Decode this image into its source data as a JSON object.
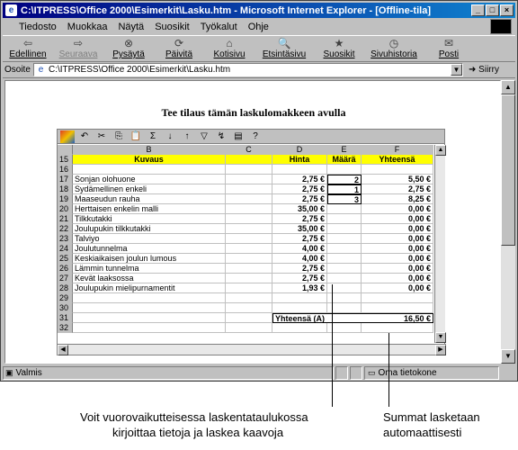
{
  "window": {
    "title": "C:\\ITPRESS\\Office 2000\\Esimerkit\\Lasku.htm - Microsoft Internet Explorer - [Offline-tila]",
    "buttons": [
      "_",
      "□",
      "×"
    ]
  },
  "menu": [
    "Tiedosto",
    "Muokkaa",
    "Näytä",
    "Suosikit",
    "Työkalut",
    "Ohje"
  ],
  "toolbar": [
    {
      "label": "Edellinen",
      "icon": "back-arrow-icon",
      "glyph": "⇦",
      "disabled": false
    },
    {
      "label": "Seuraava",
      "icon": "forward-arrow-icon",
      "glyph": "⇨",
      "disabled": true
    },
    {
      "label": "Pysäytä",
      "icon": "stop-icon",
      "glyph": "⊗",
      "disabled": false
    },
    {
      "label": "Päivitä",
      "icon": "refresh-icon",
      "glyph": "⟳",
      "disabled": false
    },
    {
      "label": "Kotisivu",
      "icon": "home-icon",
      "glyph": "⌂",
      "disabled": false
    },
    {
      "label": "Etsintäsivu",
      "icon": "search-icon",
      "glyph": "🔍",
      "disabled": false
    },
    {
      "label": "Suosikit",
      "icon": "favorites-icon",
      "glyph": "★",
      "disabled": false
    },
    {
      "label": "Sivuhistoria",
      "icon": "history-icon",
      "glyph": "◷",
      "disabled": false
    },
    {
      "label": "Posti",
      "icon": "mail-icon",
      "glyph": "✉",
      "disabled": false
    }
  ],
  "address": {
    "label": "Osoite",
    "value": "C:\\ITPRESS\\Office 2000\\Esimerkit\\Lasku.htm",
    "go": "Siirry"
  },
  "page": {
    "heading": "Tee tilaus tämän laskulomakkeen avulla"
  },
  "sheet": {
    "columns": [
      "B",
      "C",
      "D",
      "E",
      "F"
    ],
    "header_row": {
      "row": "15",
      "b": "Kuvaus",
      "c": "",
      "d": "Hinta",
      "e": "Määrä",
      "f": "Yhteensä"
    },
    "rows": [
      {
        "row": "16",
        "b": "",
        "d": "",
        "e": "",
        "f": ""
      },
      {
        "row": "17",
        "b": "Sonjan olohuone",
        "d": "2,75 €",
        "e": "2",
        "f": "5,50 €"
      },
      {
        "row": "18",
        "b": "Sydämellinen enkeli",
        "d": "2,75 €",
        "e": "1",
        "f": "2,75 €"
      },
      {
        "row": "19",
        "b": "Maaseudun rauha",
        "d": "2,75 €",
        "e": "3",
        "f": "8,25 €"
      },
      {
        "row": "20",
        "b": "Herttaisen enkelin malli",
        "d": "35,00 €",
        "e": "",
        "f": "0,00 €"
      },
      {
        "row": "21",
        "b": "Tilkkutakki",
        "d": "2,75 €",
        "e": "",
        "f": "0,00 €"
      },
      {
        "row": "22",
        "b": "Joulupukin tilkkutakki",
        "d": "35,00 €",
        "e": "",
        "f": "0,00 €"
      },
      {
        "row": "23",
        "b": "Talviyo",
        "d": "2,75 €",
        "e": "",
        "f": "0,00 €"
      },
      {
        "row": "24",
        "b": "Joulutunnelma",
        "d": "4,00 €",
        "e": "",
        "f": "0,00 €"
      },
      {
        "row": "25",
        "b": "Keskiaikaisen joulun lumous",
        "d": "4,00 €",
        "e": "",
        "f": "0,00 €"
      },
      {
        "row": "26",
        "b": "Lämmin tunnelma",
        "d": "2,75 €",
        "e": "",
        "f": "0,00 €"
      },
      {
        "row": "27",
        "b": "Kevät laaksossa",
        "d": "2,75 €",
        "e": "",
        "f": "0,00 €"
      },
      {
        "row": "28",
        "b": "Joulupukin mielipurnamentit",
        "d": "1,93 €",
        "e": "",
        "f": "0,00 €"
      },
      {
        "row": "29",
        "b": "",
        "d": "",
        "e": "",
        "f": ""
      },
      {
        "row": "30",
        "b": "",
        "d": "",
        "e": "",
        "f": ""
      }
    ],
    "total_row": {
      "row": "31",
      "label": "Yhteensä (A)",
      "value": "16,50 €"
    },
    "last_row": "32"
  },
  "status": {
    "text": "Valmis",
    "zone": "Oma tietokone"
  },
  "captions": {
    "left_line1": "Voit vuorovaikutteisessa laskentataulukossa",
    "left_line2": "kirjoittaa tietoja ja laskea  kaavoja",
    "right_line1": "Summat lasketaan",
    "right_line2": "automaattisesti"
  }
}
